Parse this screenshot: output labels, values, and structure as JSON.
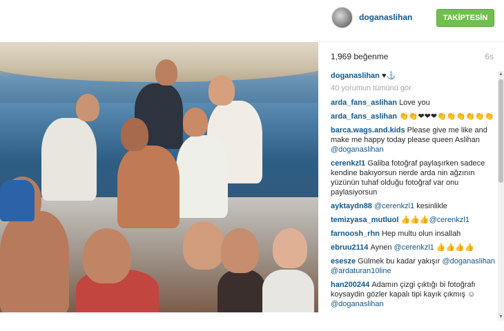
{
  "header": {
    "username": "doganaslihan",
    "follow_label": "TAKİPTESİN"
  },
  "post": {
    "likes": "1,969 beğenme",
    "time_ago": "6s"
  },
  "comments": {
    "view_all": "40 yorumun tümünü gör",
    "items": [
      {
        "user": "doganaslihan",
        "parts": [
          {
            "t": "text",
            "v": "♥⚓"
          }
        ]
      },
      {
        "user": "arda_fans_aslihan",
        "parts": [
          {
            "t": "text",
            "v": "Love you"
          }
        ]
      },
      {
        "user": "arda_fans_aslihan",
        "parts": [
          {
            "t": "text",
            "v": "👏👏❤❤❤👏👏👏👏👏👏"
          }
        ]
      },
      {
        "user": "barca.wags.and.kids",
        "parts": [
          {
            "t": "text",
            "v": "Please give me like and make me happy today please queen Aslihan "
          },
          {
            "t": "mention",
            "v": "@doganaslihan"
          }
        ]
      },
      {
        "user": "cerenkzl1",
        "parts": [
          {
            "t": "text",
            "v": "Galiba fotoğraf paylaşırken sadece kendine bakıyorsun nerde arda nin ağzının yüzünün tuhaf olduğu fotoğraf var onu paylasiyorsun"
          }
        ]
      },
      {
        "user": "ayktaydn88",
        "parts": [
          {
            "t": "mention",
            "v": "@cerenkzl1"
          },
          {
            "t": "text",
            "v": " kesinlikle"
          }
        ]
      },
      {
        "user": "temizyasa_mutluol",
        "parts": [
          {
            "t": "text",
            "v": "👍👍👍"
          },
          {
            "t": "mention",
            "v": "@cerenkzl1"
          }
        ]
      },
      {
        "user": "farnoosh_rhn",
        "parts": [
          {
            "t": "text",
            "v": "Hep multu olun insallah"
          }
        ]
      },
      {
        "user": "ebruu2114",
        "parts": [
          {
            "t": "text",
            "v": "Aynen "
          },
          {
            "t": "mention",
            "v": "@cerenkzl1"
          },
          {
            "t": "text",
            "v": " 👍👍👍👍"
          }
        ]
      },
      {
        "user": "esesze",
        "parts": [
          {
            "t": "text",
            "v": "Gülmek bu kadar yakışır "
          },
          {
            "t": "mention",
            "v": "@doganaslihan"
          },
          {
            "t": "text",
            "v": " "
          },
          {
            "t": "mention",
            "v": "@ardaturan10line"
          }
        ]
      },
      {
        "user": "han200244",
        "parts": [
          {
            "t": "text",
            "v": "Adamın çizgi çıktığı bi fotoğrafı koysaydin gözler kapalı tipi kayık çıkmış ☺ "
          },
          {
            "t": "mention",
            "v": "@doganaslihan"
          }
        ]
      }
    ]
  },
  "icons": {
    "avatar": "avatar-image",
    "scroll_up": "scroll-up-arrow-icon",
    "scroll_down": "scroll-down-arrow-icon"
  },
  "colors": {
    "username": "#125688",
    "follow_button": "#70c050",
    "muted": "#a5a7aa"
  }
}
